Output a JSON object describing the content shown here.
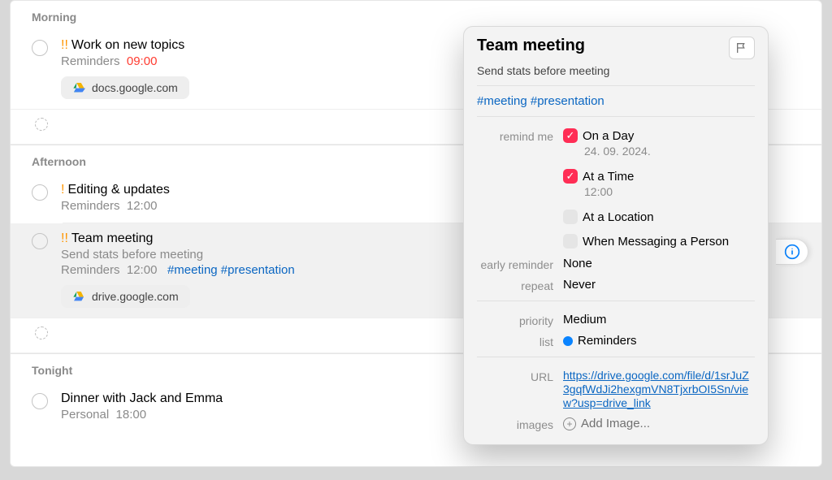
{
  "sections": {
    "morning": {
      "label": "Morning",
      "tasks": [
        {
          "priority": "!!",
          "title": "Work on new topics",
          "list": "Reminders",
          "time": "09:00",
          "time_red": true,
          "attachment": "docs.google.com"
        }
      ]
    },
    "afternoon": {
      "label": "Afternoon",
      "tasks": [
        {
          "priority": "!",
          "title": "Editing & updates",
          "list": "Reminders",
          "time": "12:00"
        },
        {
          "priority": "!!",
          "title": "Team meeting",
          "note": "Send stats before meeting",
          "list": "Reminders",
          "time": "12:00",
          "tags": "#meeting #presentation",
          "attachment": "drive.google.com",
          "selected": true
        }
      ]
    },
    "tonight": {
      "label": "Tonight",
      "tasks": [
        {
          "title": "Dinner with Jack and Emma",
          "list": "Personal",
          "time": "18:00"
        }
      ]
    }
  },
  "popover": {
    "title": "Team meeting",
    "subtitle": "Send stats before meeting",
    "tags": "#meeting #presentation",
    "labels": {
      "remind_me": "remind me",
      "early_reminder": "early reminder",
      "repeat": "repeat",
      "priority": "priority",
      "list": "list",
      "url": "URL",
      "images": "images"
    },
    "remind": {
      "on_day": {
        "label": "On a Day",
        "checked": true,
        "date": "24. 09. 2024."
      },
      "at_time": {
        "label": "At a Time",
        "checked": true,
        "time": "12:00"
      },
      "at_location": {
        "label": "At a Location",
        "checked": false
      },
      "when_messaging": {
        "label": "When Messaging a Person",
        "checked": false
      }
    },
    "early_reminder": "None",
    "repeat": "Never",
    "priority": "Medium",
    "list": "Reminders",
    "url": "https://drive.google.com/file/d/1srJuZ3gqfWdJi2hexgmVN8TjxrbOI5Sn/view?usp=drive_link",
    "add_image": "Add Image..."
  }
}
